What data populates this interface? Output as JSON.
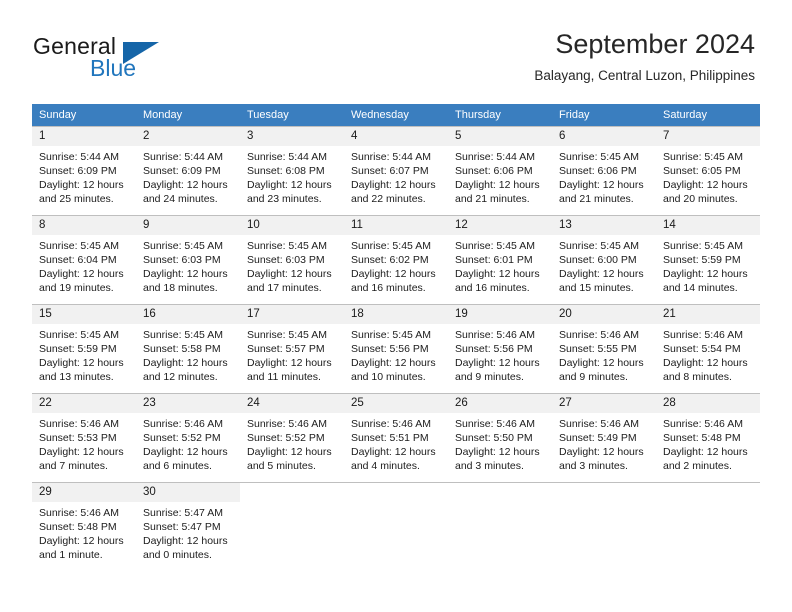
{
  "brand": {
    "name_part1": "General",
    "name_part2": "Blue",
    "flag_icon": "triangle-flag-icon",
    "accent_color": "#2176bd"
  },
  "header": {
    "title": "September 2024",
    "location": "Balayang, Central Luzon, Philippines"
  },
  "calendar": {
    "header_background": "#3a7ebf",
    "daynum_background": "#f1f1f1",
    "weekdays": [
      "Sunday",
      "Monday",
      "Tuesday",
      "Wednesday",
      "Thursday",
      "Friday",
      "Saturday"
    ],
    "weeks": [
      [
        {
          "day": "1",
          "sunrise": "Sunrise: 5:44 AM",
          "sunset": "Sunset: 6:09 PM",
          "daylight1": "Daylight: 12 hours",
          "daylight2": "and 25 minutes."
        },
        {
          "day": "2",
          "sunrise": "Sunrise: 5:44 AM",
          "sunset": "Sunset: 6:09 PM",
          "daylight1": "Daylight: 12 hours",
          "daylight2": "and 24 minutes."
        },
        {
          "day": "3",
          "sunrise": "Sunrise: 5:44 AM",
          "sunset": "Sunset: 6:08 PM",
          "daylight1": "Daylight: 12 hours",
          "daylight2": "and 23 minutes."
        },
        {
          "day": "4",
          "sunrise": "Sunrise: 5:44 AM",
          "sunset": "Sunset: 6:07 PM",
          "daylight1": "Daylight: 12 hours",
          "daylight2": "and 22 minutes."
        },
        {
          "day": "5",
          "sunrise": "Sunrise: 5:44 AM",
          "sunset": "Sunset: 6:06 PM",
          "daylight1": "Daylight: 12 hours",
          "daylight2": "and 21 minutes."
        },
        {
          "day": "6",
          "sunrise": "Sunrise: 5:45 AM",
          "sunset": "Sunset: 6:06 PM",
          "daylight1": "Daylight: 12 hours",
          "daylight2": "and 21 minutes."
        },
        {
          "day": "7",
          "sunrise": "Sunrise: 5:45 AM",
          "sunset": "Sunset: 6:05 PM",
          "daylight1": "Daylight: 12 hours",
          "daylight2": "and 20 minutes."
        }
      ],
      [
        {
          "day": "8",
          "sunrise": "Sunrise: 5:45 AM",
          "sunset": "Sunset: 6:04 PM",
          "daylight1": "Daylight: 12 hours",
          "daylight2": "and 19 minutes."
        },
        {
          "day": "9",
          "sunrise": "Sunrise: 5:45 AM",
          "sunset": "Sunset: 6:03 PM",
          "daylight1": "Daylight: 12 hours",
          "daylight2": "and 18 minutes."
        },
        {
          "day": "10",
          "sunrise": "Sunrise: 5:45 AM",
          "sunset": "Sunset: 6:03 PM",
          "daylight1": "Daylight: 12 hours",
          "daylight2": "and 17 minutes."
        },
        {
          "day": "11",
          "sunrise": "Sunrise: 5:45 AM",
          "sunset": "Sunset: 6:02 PM",
          "daylight1": "Daylight: 12 hours",
          "daylight2": "and 16 minutes."
        },
        {
          "day": "12",
          "sunrise": "Sunrise: 5:45 AM",
          "sunset": "Sunset: 6:01 PM",
          "daylight1": "Daylight: 12 hours",
          "daylight2": "and 16 minutes."
        },
        {
          "day": "13",
          "sunrise": "Sunrise: 5:45 AM",
          "sunset": "Sunset: 6:00 PM",
          "daylight1": "Daylight: 12 hours",
          "daylight2": "and 15 minutes."
        },
        {
          "day": "14",
          "sunrise": "Sunrise: 5:45 AM",
          "sunset": "Sunset: 5:59 PM",
          "daylight1": "Daylight: 12 hours",
          "daylight2": "and 14 minutes."
        }
      ],
      [
        {
          "day": "15",
          "sunrise": "Sunrise: 5:45 AM",
          "sunset": "Sunset: 5:59 PM",
          "daylight1": "Daylight: 12 hours",
          "daylight2": "and 13 minutes."
        },
        {
          "day": "16",
          "sunrise": "Sunrise: 5:45 AM",
          "sunset": "Sunset: 5:58 PM",
          "daylight1": "Daylight: 12 hours",
          "daylight2": "and 12 minutes."
        },
        {
          "day": "17",
          "sunrise": "Sunrise: 5:45 AM",
          "sunset": "Sunset: 5:57 PM",
          "daylight1": "Daylight: 12 hours",
          "daylight2": "and 11 minutes."
        },
        {
          "day": "18",
          "sunrise": "Sunrise: 5:45 AM",
          "sunset": "Sunset: 5:56 PM",
          "daylight1": "Daylight: 12 hours",
          "daylight2": "and 10 minutes."
        },
        {
          "day": "19",
          "sunrise": "Sunrise: 5:46 AM",
          "sunset": "Sunset: 5:56 PM",
          "daylight1": "Daylight: 12 hours",
          "daylight2": "and 9 minutes."
        },
        {
          "day": "20",
          "sunrise": "Sunrise: 5:46 AM",
          "sunset": "Sunset: 5:55 PM",
          "daylight1": "Daylight: 12 hours",
          "daylight2": "and 9 minutes."
        },
        {
          "day": "21",
          "sunrise": "Sunrise: 5:46 AM",
          "sunset": "Sunset: 5:54 PM",
          "daylight1": "Daylight: 12 hours",
          "daylight2": "and 8 minutes."
        }
      ],
      [
        {
          "day": "22",
          "sunrise": "Sunrise: 5:46 AM",
          "sunset": "Sunset: 5:53 PM",
          "daylight1": "Daylight: 12 hours",
          "daylight2": "and 7 minutes."
        },
        {
          "day": "23",
          "sunrise": "Sunrise: 5:46 AM",
          "sunset": "Sunset: 5:52 PM",
          "daylight1": "Daylight: 12 hours",
          "daylight2": "and 6 minutes."
        },
        {
          "day": "24",
          "sunrise": "Sunrise: 5:46 AM",
          "sunset": "Sunset: 5:52 PM",
          "daylight1": "Daylight: 12 hours",
          "daylight2": "and 5 minutes."
        },
        {
          "day": "25",
          "sunrise": "Sunrise: 5:46 AM",
          "sunset": "Sunset: 5:51 PM",
          "daylight1": "Daylight: 12 hours",
          "daylight2": "and 4 minutes."
        },
        {
          "day": "26",
          "sunrise": "Sunrise: 5:46 AM",
          "sunset": "Sunset: 5:50 PM",
          "daylight1": "Daylight: 12 hours",
          "daylight2": "and 3 minutes."
        },
        {
          "day": "27",
          "sunrise": "Sunrise: 5:46 AM",
          "sunset": "Sunset: 5:49 PM",
          "daylight1": "Daylight: 12 hours",
          "daylight2": "and 3 minutes."
        },
        {
          "day": "28",
          "sunrise": "Sunrise: 5:46 AM",
          "sunset": "Sunset: 5:48 PM",
          "daylight1": "Daylight: 12 hours",
          "daylight2": "and 2 minutes."
        }
      ],
      [
        {
          "day": "29",
          "sunrise": "Sunrise: 5:46 AM",
          "sunset": "Sunset: 5:48 PM",
          "daylight1": "Daylight: 12 hours",
          "daylight2": "and 1 minute."
        },
        {
          "day": "30",
          "sunrise": "Sunrise: 5:47 AM",
          "sunset": "Sunset: 5:47 PM",
          "daylight1": "Daylight: 12 hours",
          "daylight2": "and 0 minutes."
        },
        {
          "day": "",
          "sunrise": "",
          "sunset": "",
          "daylight1": "",
          "daylight2": ""
        },
        {
          "day": "",
          "sunrise": "",
          "sunset": "",
          "daylight1": "",
          "daylight2": ""
        },
        {
          "day": "",
          "sunrise": "",
          "sunset": "",
          "daylight1": "",
          "daylight2": ""
        },
        {
          "day": "",
          "sunrise": "",
          "sunset": "",
          "daylight1": "",
          "daylight2": ""
        },
        {
          "day": "",
          "sunrise": "",
          "sunset": "",
          "daylight1": "",
          "daylight2": ""
        }
      ]
    ]
  }
}
